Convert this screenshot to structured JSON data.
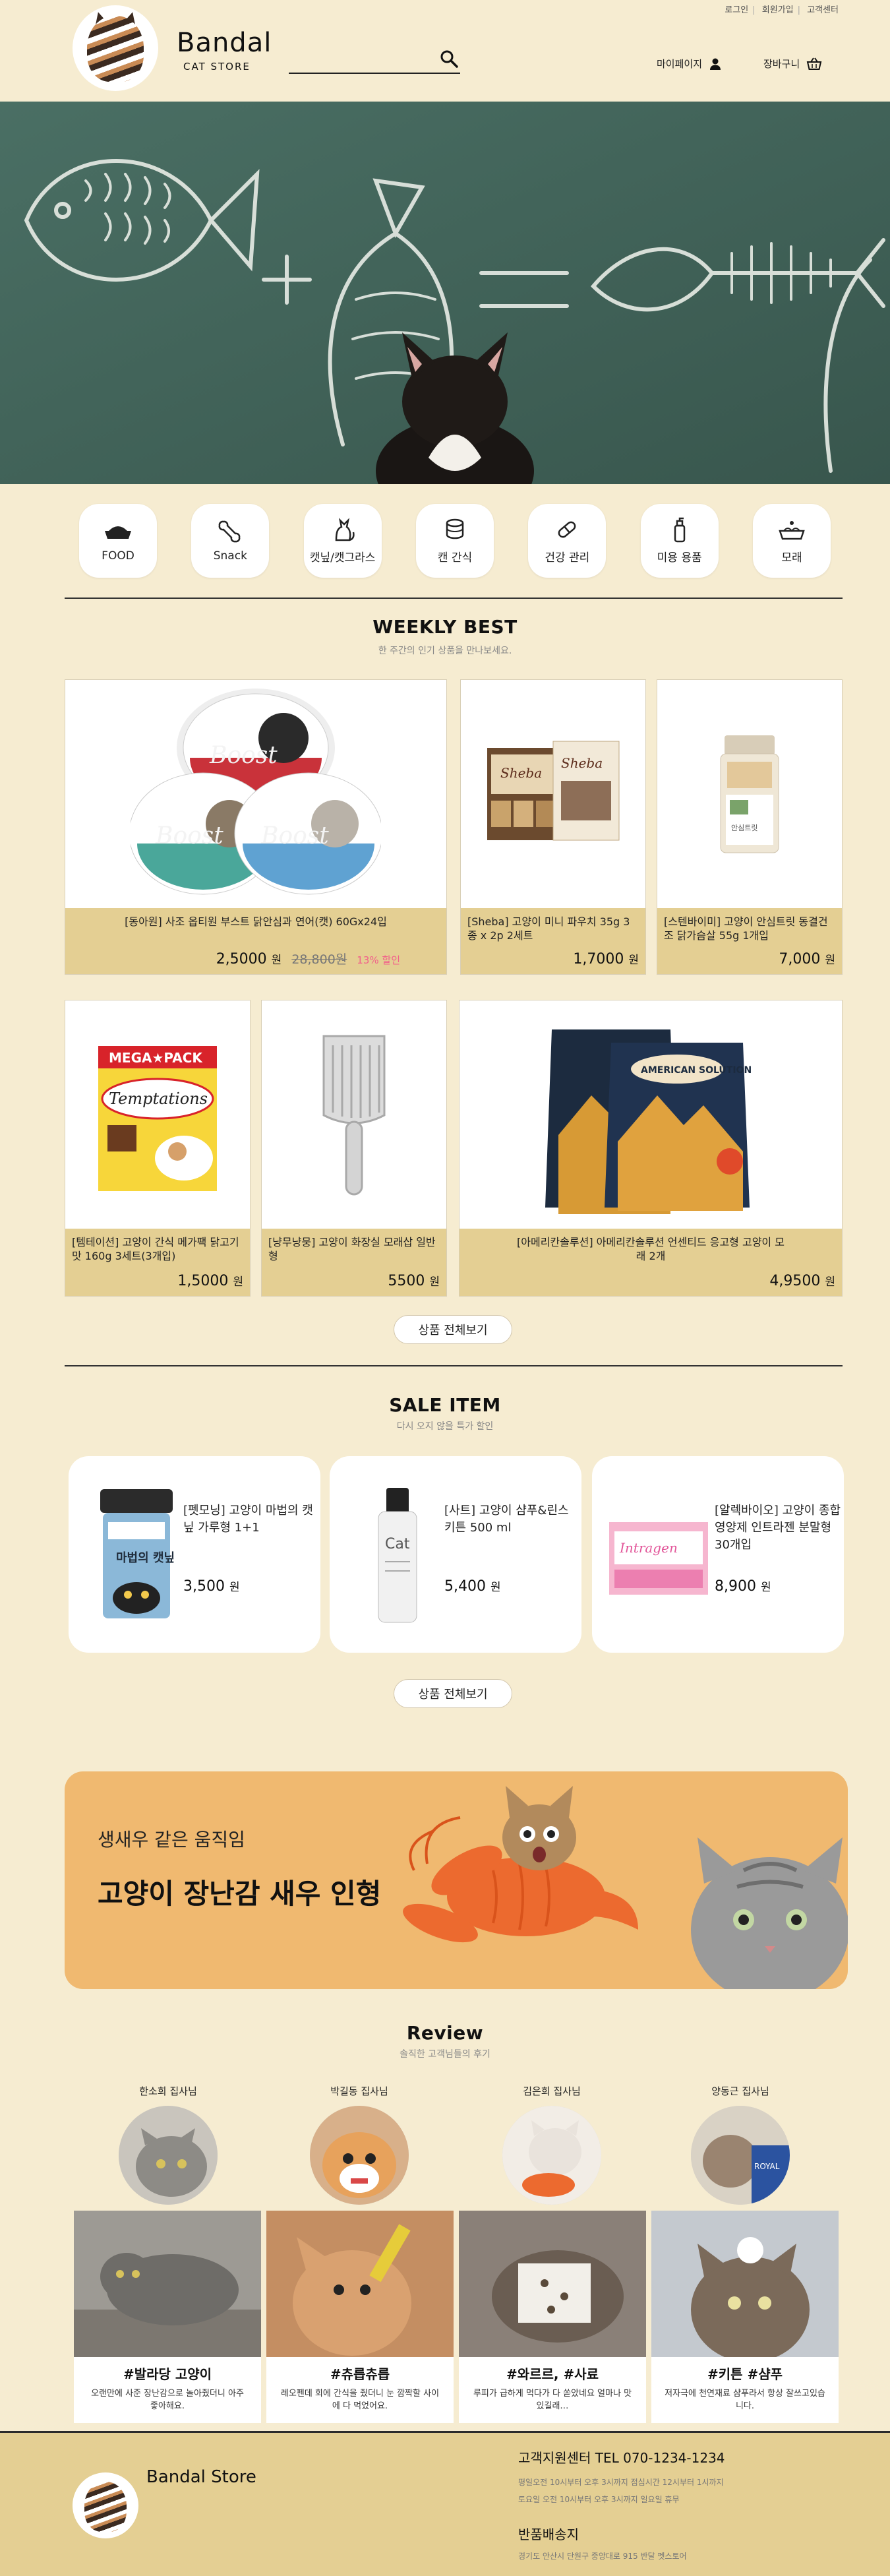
{
  "header": {
    "top_links": [
      "로그인",
      "회원가입",
      "고객센터"
    ],
    "brand": "Bandal",
    "brand_sub": "CAT STORE",
    "search_placeholder": "",
    "mypage": "마이페이지",
    "cart": "장바구니"
  },
  "categories": [
    {
      "label": "FOOD",
      "icon": "food-bowl-icon"
    },
    {
      "label": "Snack",
      "icon": "bone-icon"
    },
    {
      "label": "캣닢/캣그라스",
      "icon": "cat-icon"
    },
    {
      "label": "캔 간식",
      "icon": "can-icon"
    },
    {
      "label": "건강 관리",
      "icon": "pill-icon"
    },
    {
      "label": "미용 용품",
      "icon": "shampoo-icon"
    },
    {
      "label": "모래",
      "icon": "litter-icon"
    }
  ],
  "weekly": {
    "title": "WEEKLY BEST",
    "sub": "한 주간의 인기 상품을 만나보세요.",
    "products": [
      {
        "name": "[동아원] 사조 옵티원 부스트 닭안심과 연어(캣) 60Gx24입",
        "price": "2,5000",
        "won": "원",
        "old_price": "28,800원",
        "discount": "13% 할인"
      },
      {
        "name": "[Sheba] 고양이 미니 파우치 35g 3종 x 2p 2세트",
        "price": "1,7000",
        "won": "원"
      },
      {
        "name": "[스텐바이미] 고양이 안심트릿 동결건조 닭가슴살 55g 1개입",
        "price": "7,000",
        "won": "원"
      },
      {
        "name": "[템테이션] 고양이 간식 메가팩 닭고기맛 160g 3세트(3개입)",
        "price": "1,5000",
        "won": "원"
      },
      {
        "name": "[냥무냥뭉] 고양이 화장실 모래삽 일반형",
        "price": "5500",
        "won": "원"
      },
      {
        "name": "[아메리칸솔루션] 아메리칸솔루션 언센티드 응고형 고양이 모래 2개",
        "price": "4,9500",
        "won": "원"
      }
    ],
    "more": "상품 전체보기"
  },
  "sale": {
    "title": "SALE ITEM",
    "sub": "다시 오지 않을 특가 할인",
    "items": [
      {
        "name": "[펫모닝] 고양이 마법의 캣닢 가루형 1+1",
        "price": "3,500",
        "won": "원",
        "jar_label": "마법의 캣닢"
      },
      {
        "name": "[사트] 고양이 샴푸&린스 키튼 500 ml",
        "price": "5,400",
        "won": "원",
        "bottle_label": "Cat"
      },
      {
        "name": "[알렉바이오] 고양이 종합 영양제 인트라젠 분말형 30개입",
        "price": "8,900",
        "won": "원",
        "box_label": "Intragen"
      }
    ],
    "more": "상품 전체보기"
  },
  "banner": {
    "line1": "생새우 같은 움직임",
    "line2": "고양이 장난감 새우 인형"
  },
  "review": {
    "title": "Review",
    "sub": "솔직한 고객님들의 후기",
    "reviewers": [
      "한소희 집사님",
      "박길동 집사님",
      "김은희 집사님",
      "양동근 집사님"
    ],
    "cards": [
      {
        "tag": "#발라당 고양이",
        "desc": "오랜만에 사준 장난감으로 놀아줬더니 아주 좋아해요."
      },
      {
        "tag": "#츄릅츄릅",
        "desc": "레오펜데 회에 간식을 줬더니 눈 깜짝할 사이에 다 먹었어요."
      },
      {
        "tag": "#와르르, #사료",
        "desc": "루피가 급하게 먹다가 다 쏟았네요 얼마나 맛있길래…"
      },
      {
        "tag": "#키튼 #샴푸",
        "desc": "저자극에 천연재료 샴푸라서 항상 잘쓰고있습니다."
      }
    ]
  },
  "footer": {
    "brand": "Bandal Store",
    "cs": "고객지원센터   TEL 070-1234-1234",
    "hours1": "평일오전 10시부터 오후 3시까지 점심시간 12시부터 1시까지",
    "hours2": "토요일 오전 10시부터 오후 3시까지 일요일 휴무",
    "return_title": "반품배송지",
    "return_addr": "경기도 안산시 단원구 중앙대로 915 반달 펫스토어"
  },
  "colors": {
    "background": "#f6ecd1",
    "accent": "#e4cf93",
    "banner": "#f0b970",
    "discount": "#f25f8b"
  }
}
